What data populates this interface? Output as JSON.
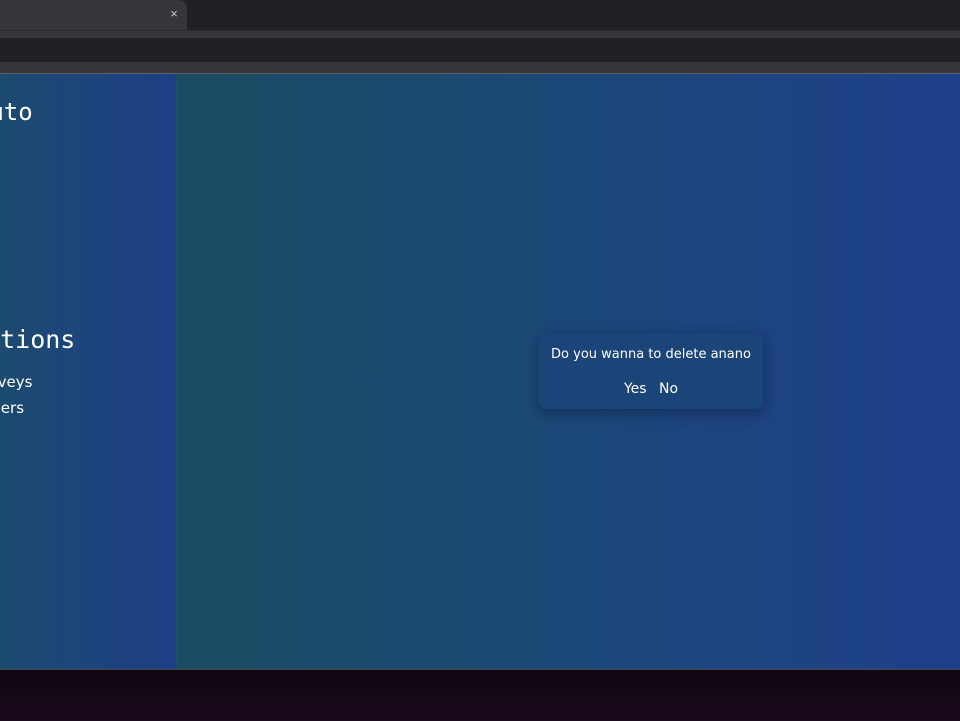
{
  "browser": {
    "tab_close_glyph": "×",
    "tab_close_icon": "close-icon"
  },
  "sidebar": {
    "brand": "tsAuto",
    "section_heading": "ections",
    "items": [
      {
        "label": "urveys"
      },
      {
        "label": "Users"
      }
    ]
  },
  "dialog": {
    "message": "Do you wanna to delete anano",
    "yes_label": "Yes",
    "no_label": "No"
  },
  "colors": {
    "sidebar": "#1e3f86",
    "main_left": "#1a4c62",
    "main_right": "#1f3f8a",
    "dialog": "#1b4478",
    "text": "#ffffff"
  }
}
